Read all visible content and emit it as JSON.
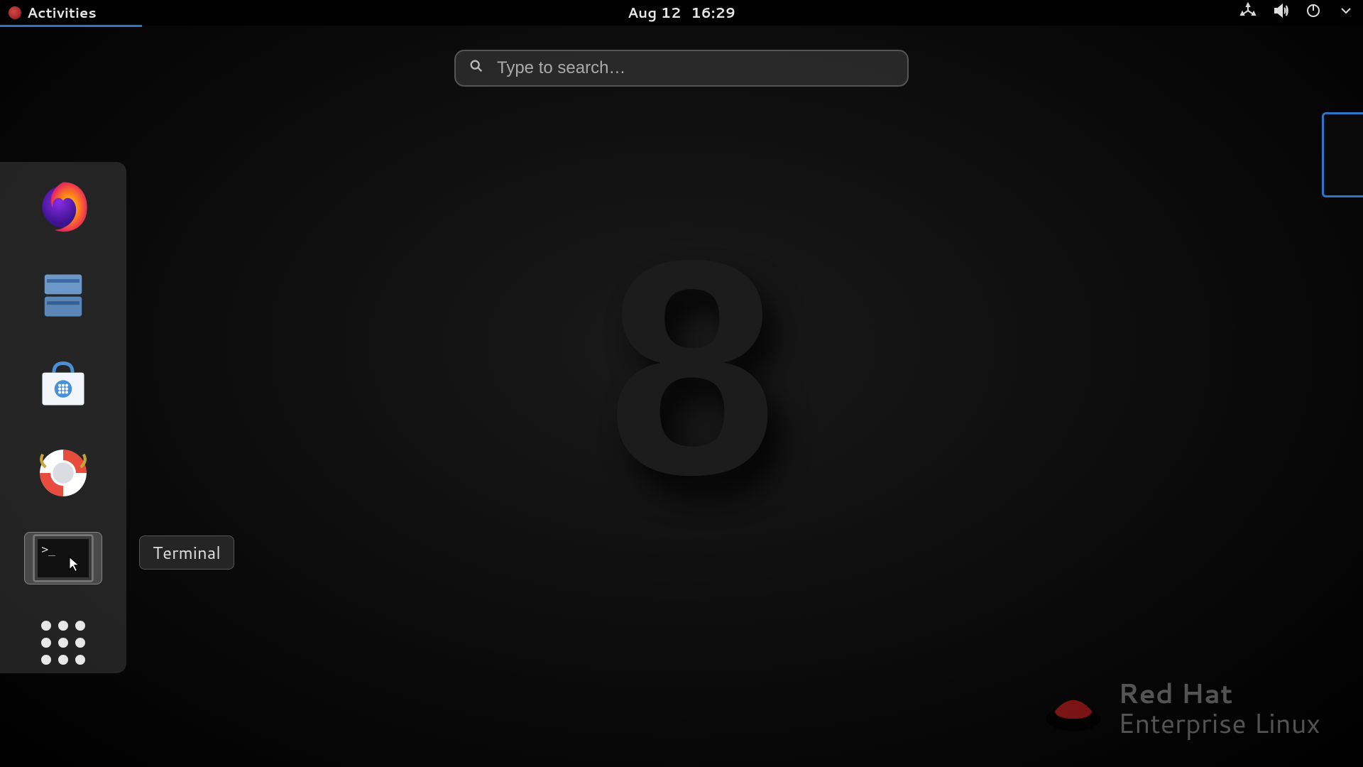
{
  "topbar": {
    "activities_label": "Activities",
    "date": "Aug 12",
    "time": "16:29"
  },
  "search": {
    "placeholder": "Type to search…",
    "value": ""
  },
  "dock": {
    "items": [
      {
        "name": "firefox",
        "tooltip": "Firefox"
      },
      {
        "name": "files",
        "tooltip": "Files"
      },
      {
        "name": "software",
        "tooltip": "Software"
      },
      {
        "name": "help",
        "tooltip": "Help"
      },
      {
        "name": "terminal",
        "tooltip": "Terminal"
      },
      {
        "name": "apps",
        "tooltip": "Show Applications"
      }
    ],
    "hovered_index": 4,
    "tooltip_text": "Terminal"
  },
  "branding": {
    "line1": "Red Hat",
    "line2": "Enterprise Linux",
    "version_glyph": "8"
  }
}
